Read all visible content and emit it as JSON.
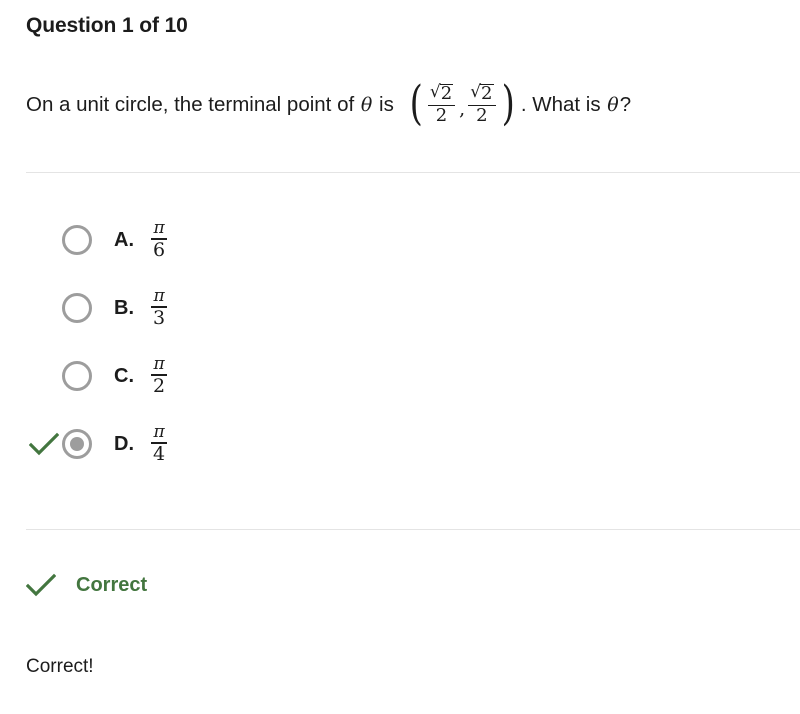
{
  "header": {
    "title": "Question 1 of 10"
  },
  "question": {
    "text_before": "On a unit circle, the terminal point of ",
    "theta_symbol": "θ",
    "text_mid": " is ",
    "point": {
      "open_paren": "(",
      "close_paren": ")",
      "comma": ",",
      "x_coordinate": {
        "numerator_radical": "√",
        "numerator_radicand": "2",
        "denominator": "2",
        "text": "√2/2"
      },
      "y_coordinate": {
        "numerator_radical": "√",
        "numerator_radicand": "2",
        "denominator": "2",
        "text": "√2/2"
      }
    },
    "text_after": ". What is ",
    "text_end": "?",
    "full_text": "On a unit circle, the terminal point of θ is (√2/2, √2/2). What is θ?"
  },
  "options": [
    {
      "letter": "A.",
      "numerator": "π",
      "denominator": "6",
      "value_text": "π/6",
      "selected": false,
      "marked_correct": false
    },
    {
      "letter": "B.",
      "numerator": "π",
      "denominator": "3",
      "value_text": "π/3",
      "selected": false,
      "marked_correct": false
    },
    {
      "letter": "C.",
      "numerator": "π",
      "denominator": "2",
      "value_text": "π/2",
      "selected": false,
      "marked_correct": false
    },
    {
      "letter": "D.",
      "numerator": "π",
      "denominator": "4",
      "value_text": "π/4",
      "selected": true,
      "marked_correct": true
    }
  ],
  "result": {
    "status_label": "Correct",
    "explanation": "Correct!",
    "check_icon": "check-icon"
  },
  "colors": {
    "text": "#1c1c1c",
    "correct_green": "#43763f",
    "radio_gray": "#9d9d9d",
    "divider": "#e4e4e4",
    "background": "#ffffff"
  }
}
